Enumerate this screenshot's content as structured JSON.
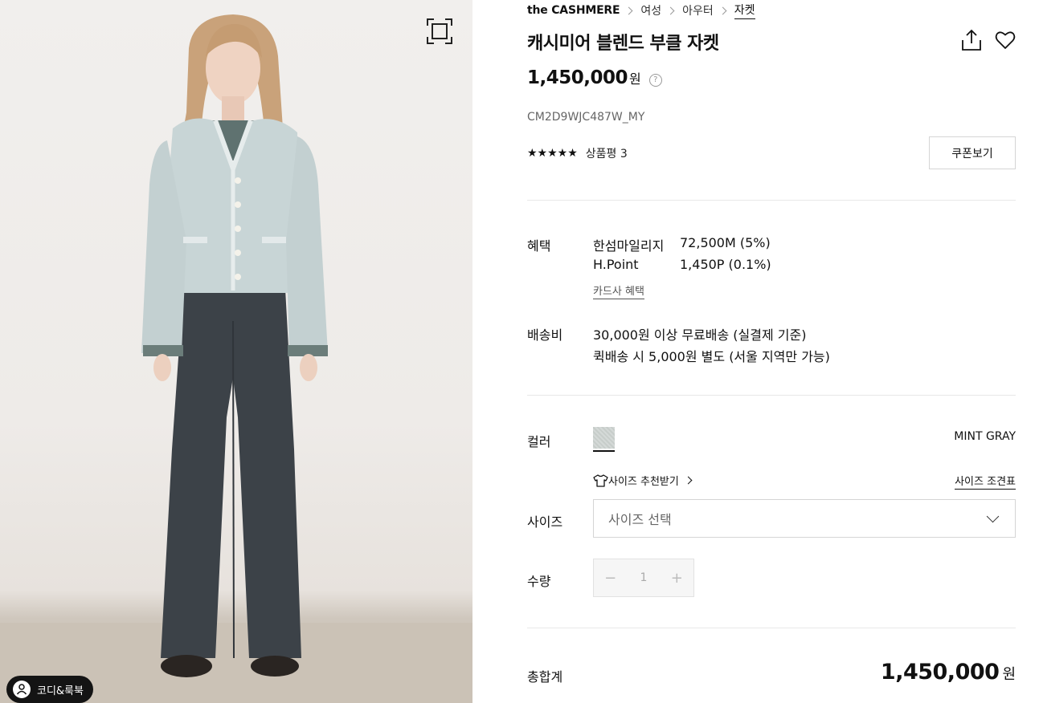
{
  "breadcrumb": {
    "brand": "the CASHMERE",
    "items": [
      "여성",
      "아우터",
      "자켓"
    ]
  },
  "product": {
    "title": "캐시미어 블렌드 부클 자켓",
    "price": "1,450,000",
    "price_unit": "원",
    "code": "CM2D9WJC487W_MY",
    "stars": "★★★★★",
    "review_label": "상품평 3"
  },
  "buttons": {
    "coupon": "쿠폰보기",
    "cody": "코디&룩북"
  },
  "benefit": {
    "label": "혜택",
    "rows": [
      {
        "name": "한섬마일리지",
        "value": "72,500M (5%)"
      },
      {
        "name": "H.Point",
        "value": "1,450P (0.1%)"
      }
    ],
    "card_link": "카드사 혜택"
  },
  "shipping": {
    "label": "배송비",
    "line1": "30,000원 이상 무료배송 (실결제 기준)",
    "line2": "퀵배송 시 5,000원 별도 (서울 지역만 가능)"
  },
  "color": {
    "label": "컬러",
    "selected": "MINT GRAY",
    "swatch": "#cfd5d3"
  },
  "size": {
    "recommend": "사이즈 추천받기",
    "chart": "사이즈 조견표",
    "label": "사이즈",
    "placeholder": "사이즈 선택"
  },
  "quantity": {
    "label": "수량",
    "value": "1",
    "minus": "−",
    "plus": "+"
  },
  "total": {
    "label": "총합계",
    "amount": "1,450,000",
    "unit": "원"
  },
  "icons": [
    "fullscreen-icon",
    "share-icon",
    "heart-icon",
    "help-icon",
    "tshirt-icon",
    "person-icon"
  ]
}
